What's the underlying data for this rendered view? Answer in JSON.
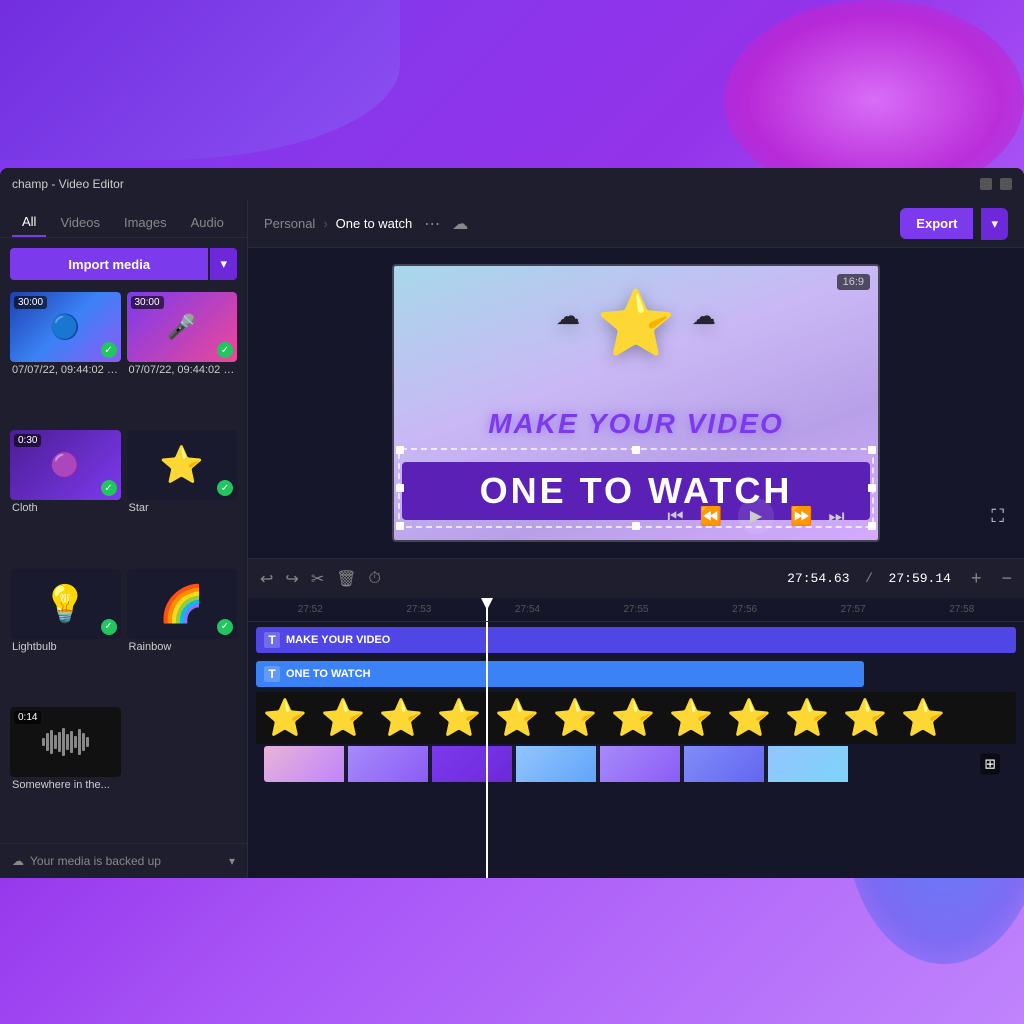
{
  "window": {
    "title": "champ - Video Editor",
    "aspect_ratio": "16:9"
  },
  "titlebar": {
    "minimize": "—",
    "maximize": "□"
  },
  "sidebar": {
    "tabs": [
      {
        "id": "all",
        "label": "All"
      },
      {
        "id": "videos",
        "label": "Videos"
      },
      {
        "id": "images",
        "label": "Images"
      },
      {
        "id": "audio",
        "label": "Audio"
      }
    ],
    "import_button": "Import media",
    "media_items": [
      {
        "id": "item1",
        "label": "07/07/22, 09:44:02 -...",
        "badge": "30:00",
        "has_check": true,
        "type": "blue_particles"
      },
      {
        "id": "item2",
        "label": "07/07/22, 09:44:02 -...",
        "badge": "30:00",
        "has_check": true,
        "type": "pink_character"
      },
      {
        "id": "item3",
        "label": "Cloth",
        "badge": "0:30",
        "has_check": true,
        "type": "purple_glow"
      },
      {
        "id": "item4",
        "label": "Star",
        "badge": "",
        "has_check": true,
        "type": "star_dark"
      },
      {
        "id": "item5",
        "label": "Lightbulb",
        "badge": "",
        "has_check": true,
        "type": "lightbulb_dark"
      },
      {
        "id": "item6",
        "label": "Rainbow",
        "badge": "",
        "has_check": true,
        "type": "rainbow_dark"
      },
      {
        "id": "item7",
        "label": "Somewhere in the...",
        "badge": "0:14",
        "has_check": false,
        "type": "audio"
      }
    ],
    "footer": "Your media is backed up"
  },
  "topbar": {
    "breadcrumb_parent": "Personal",
    "breadcrumb_current": "One to watch",
    "export_label": "Export"
  },
  "preview": {
    "text_top": "MAKE YOUR VIDEO",
    "text_bottom": "ONE TO WATCH"
  },
  "timeline": {
    "current_time": "27:54.63",
    "total_time": "27:59.14",
    "ruler_marks": [
      "27:52",
      "27:53",
      "27:54",
      "27:55",
      "27:56",
      "27:57",
      "27:58"
    ],
    "tracks": [
      {
        "id": "track-make",
        "type": "text",
        "label": "MAKE YOUR VIDEO"
      },
      {
        "id": "track-watch",
        "type": "text",
        "label": "ONE TO WATCH"
      },
      {
        "id": "track-stars",
        "type": "stars"
      },
      {
        "id": "track-video",
        "type": "video"
      }
    ]
  },
  "icons": {
    "chevron_down": "▾",
    "chevron_right": "›",
    "more": "⋯",
    "cloud": "☁",
    "undo": "↩",
    "redo": "↪",
    "cut": "✂",
    "trash": "🗑",
    "timer": "⏱",
    "plus": "+",
    "minus": "−",
    "skip_back": "⏮",
    "rewind": "⏪",
    "play": "▶",
    "fast_forward": "⏩",
    "skip_forward": "⏭",
    "fullscreen": "⛶",
    "check": "✓",
    "backup": "☁",
    "shield": "🛡"
  }
}
